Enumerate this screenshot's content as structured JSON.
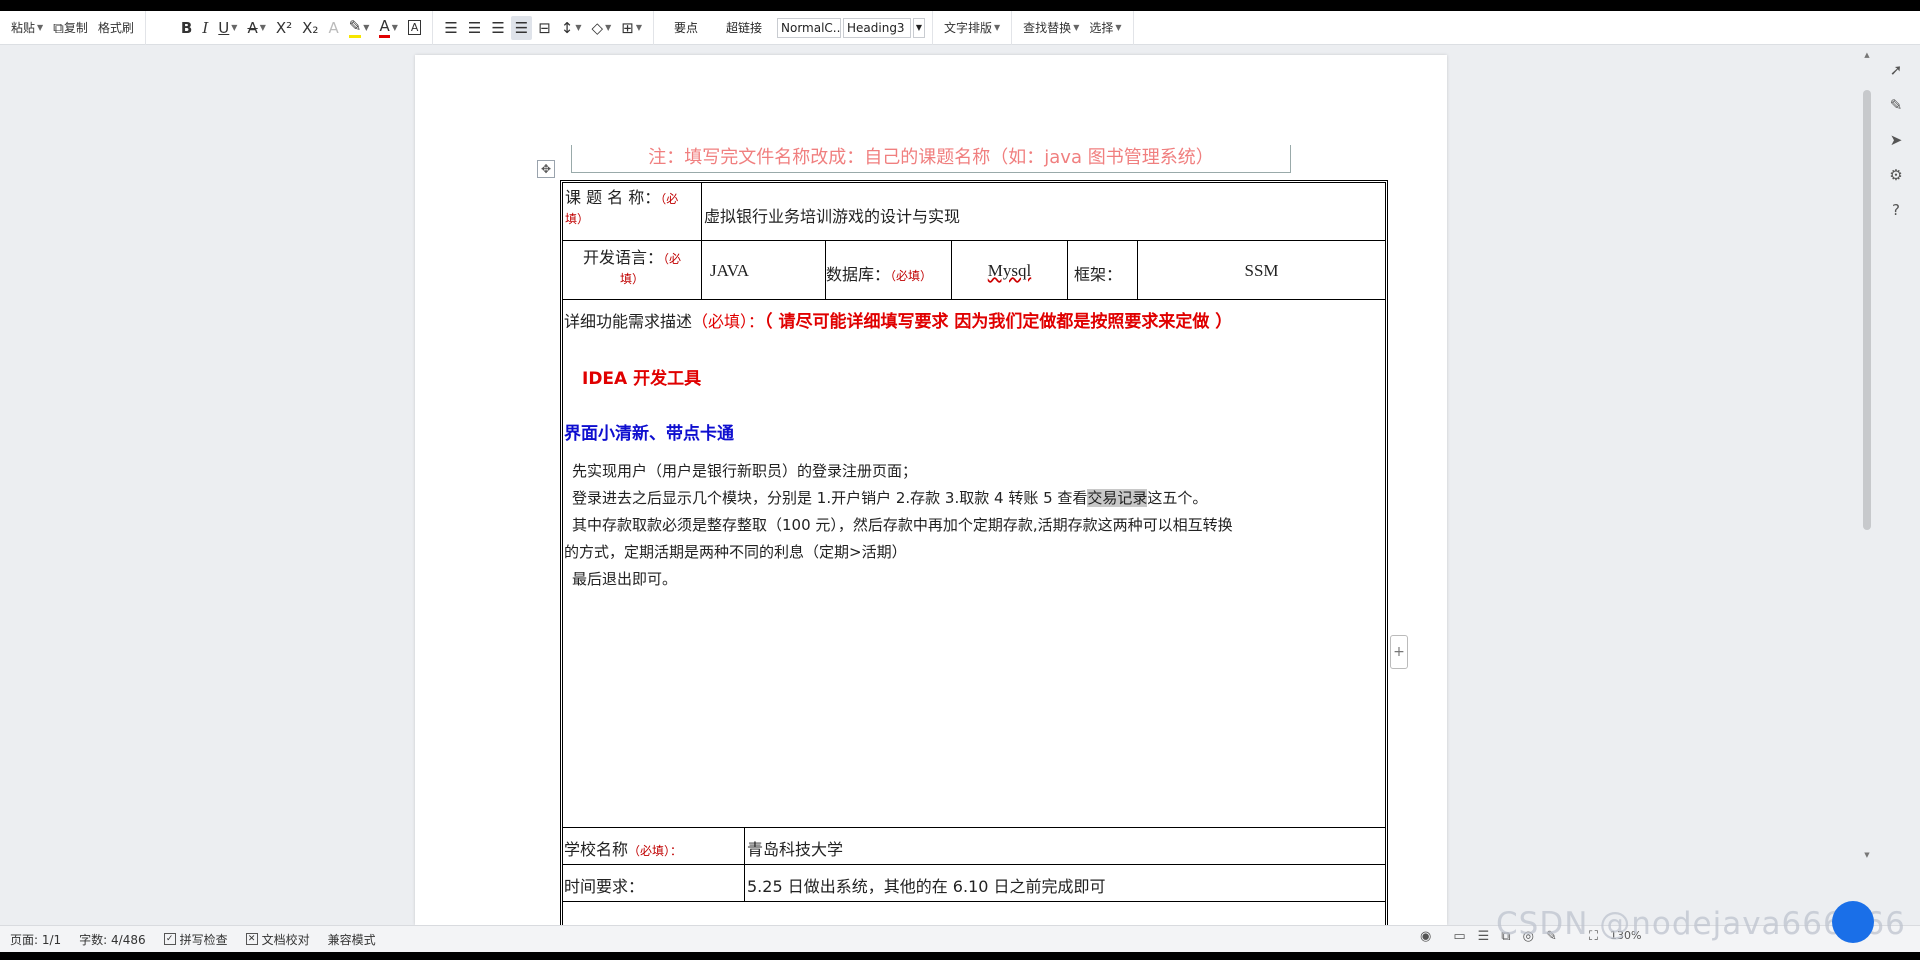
{
  "toolbar": {
    "paste": "粘贴",
    "copy": "复制",
    "format_painter": "格式刷",
    "style_key": "要点",
    "style_link": "超链接",
    "style_normal": "NormalC...",
    "style_heading": "Heading3",
    "text_layout": "文字排版",
    "find_replace": "查找替换",
    "select": "选择"
  },
  "document": {
    "note": "注：填写完文件名称改成：自己的课题名称（如：java 图书管理系统）",
    "topic_label": "课 题 名 称：",
    "topic_req_1": "（必",
    "topic_req_2": "填）",
    "topic_value": "虚拟银行业务培训游戏的设计与实现",
    "lang_label": "开发语言：",
    "lang_req_1": "（必",
    "lang_req_2": "填）",
    "lang_value": "JAVA",
    "db_label": "数据库：",
    "db_req": "（必填）",
    "db_value": "Mysql",
    "framework_label": "框架：",
    "framework_value": "SSM",
    "desc_label": "详细功能需求描述",
    "desc_req": "（必填）：",
    "desc_emphasis": "（ 请尽可能详细填写要求  因为我们定做都是按照要求来定做 ）",
    "idea_line": "IDEA 开发工具",
    "ui_line": "界面小清新、带点卡通",
    "body_line1": "先实现用户（用户是银行新职员）的登录注册页面；",
    "body_line2_a": "登录进去之后显示几个模块，分别是 1.开户销户 2.存款 3.取款 4 转账 5 查看",
    "body_line2_hl": "交易记录",
    "body_line2_b": "这五个。",
    "body_line3": "其中存款取款必须是整存整取（100 元），然后存款中再加个定期存款,活期存款这两种可以相互转换",
    "body_line4": "的方式，定期活期是两种不同的利息（定期>活期）",
    "body_line5": "最后退出即可。",
    "school_label": "学校名称",
    "school_req": "（必填）：",
    "school_value": "青岛科技大学",
    "time_label": "时间要求：",
    "time_value": "5.25 日做出系统，其他的在 6.10 日之前完成即可"
  },
  "status": {
    "page": "页面: 1/1",
    "word_count": "字数: 4/486",
    "spell_check": "拼写检查",
    "doc_proof": "文档校对",
    "compat_mode": "兼容模式",
    "zoom": "130%"
  },
  "watermark": "CSDN @nodejava666666"
}
